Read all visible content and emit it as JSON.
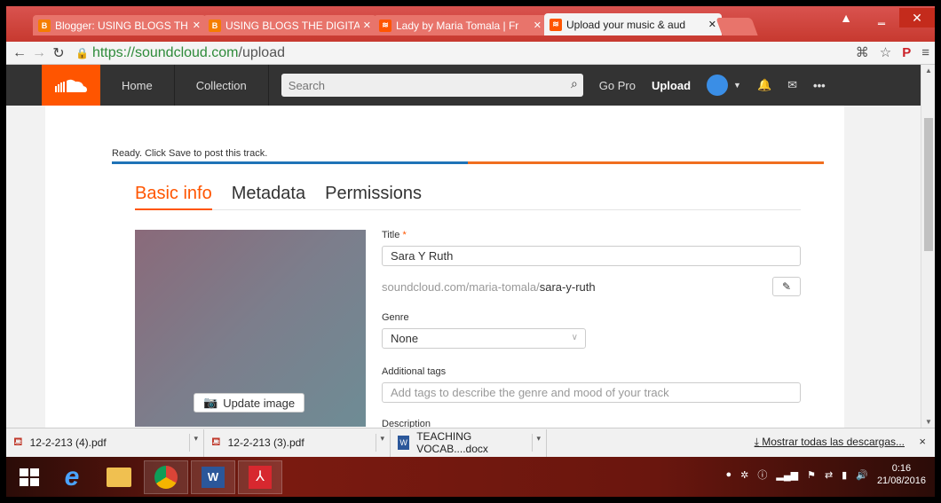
{
  "browser": {
    "tabs": [
      {
        "label": "Blogger: USING BLOGS TH",
        "icon": "blogger"
      },
      {
        "label": "USING BLOGS THE DIGITA",
        "icon": "blogger"
      },
      {
        "label": "Lady by Maria Tomala | Fr",
        "icon": "soundcloud"
      },
      {
        "label": "Upload your music & aud",
        "icon": "soundcloud",
        "active": true
      }
    ],
    "url_host": "https://soundcloud.com",
    "url_path": "/upload"
  },
  "sc_header": {
    "home": "Home",
    "collection": "Collection",
    "search_placeholder": "Search",
    "go_pro": "Go Pro",
    "upload": "Upload"
  },
  "upload": {
    "status": "Ready. Click Save to post this track.",
    "progress": 1.0,
    "tabs": [
      "Basic info",
      "Metadata",
      "Permissions"
    ],
    "update_image": "Update image",
    "title_label": "Title",
    "title_required": "*",
    "title_value": "Sara Y Ruth",
    "permalink_base": "soundcloud.com/maria-tomala/",
    "permalink_slug": "sara-y-ruth",
    "genre_label": "Genre",
    "genre_value": "None",
    "tags_label": "Additional tags",
    "tags_placeholder": "Add tags to describe the genre and mood of your track",
    "description_label": "Description"
  },
  "downloads": {
    "items": [
      {
        "name": "12-2-213 (4).pdf",
        "type": "pdf"
      },
      {
        "name": "12-2-213 (3).pdf",
        "type": "pdf"
      },
      {
        "name": "TEACHING VOCAB....docx",
        "type": "docx"
      }
    ],
    "show_all": "Mostrar todas las descargas...",
    "close": "×"
  },
  "taskbar": {
    "time": "0:16",
    "date": "21/08/2016"
  },
  "colors": {
    "accent": "#ff5500",
    "header_bg": "#333333",
    "progress_blue": "#1f73b7",
    "progress_orange": "#f06e1f"
  }
}
